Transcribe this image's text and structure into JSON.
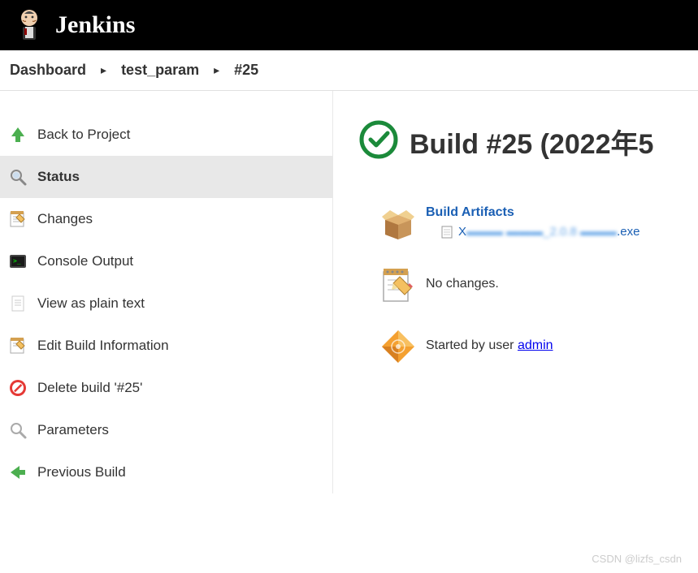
{
  "header": {
    "logo_text": "Jenkins"
  },
  "breadcrumbs": [
    {
      "label": "Dashboard"
    },
    {
      "label": "test_param"
    },
    {
      "label": "#25"
    }
  ],
  "sidebar": {
    "items": [
      {
        "label": "Back to Project",
        "icon": "arrow-up-green"
      },
      {
        "label": "Status",
        "icon": "magnify",
        "active": true
      },
      {
        "label": "Changes",
        "icon": "notepad"
      },
      {
        "label": "Console Output",
        "icon": "terminal"
      },
      {
        "label": "View as plain text",
        "icon": "document"
      },
      {
        "label": "Edit Build Information",
        "icon": "notepad-edit"
      },
      {
        "label": "Delete build '#25'",
        "icon": "delete-red"
      },
      {
        "label": "Parameters",
        "icon": "search-grey"
      },
      {
        "label": "Previous Build",
        "icon": "arrow-left-green"
      }
    ]
  },
  "content": {
    "build_title": "Build #25 (2022年5",
    "artifacts": {
      "heading": "Build Artifacts",
      "file_prefix": "X",
      "file_blur": "▬▬▬  ▬▬▬_2.0.8 ▬▬▬",
      "file_suffix": ".exe"
    },
    "changes": {
      "text": "No changes."
    },
    "started": {
      "prefix": "Started by user ",
      "user": "admin"
    }
  },
  "watermark": "CSDN @lizfs_csdn"
}
